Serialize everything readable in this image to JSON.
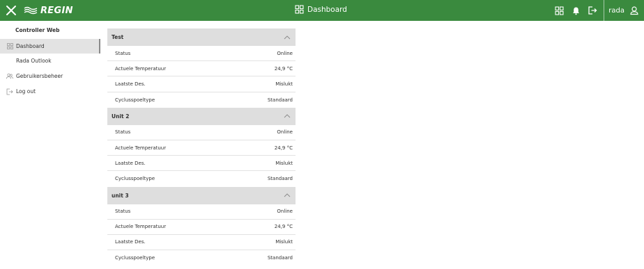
{
  "topbar": {
    "brand": "REGIN",
    "title": "Dashboard",
    "user": "rada"
  },
  "sidebar": {
    "title": "Controller Web",
    "items": [
      {
        "label": "Dashboard",
        "icon": "grid-icon",
        "active": true
      },
      {
        "label": "Rada Outlook",
        "icon": "",
        "active": false
      },
      {
        "label": "Gebruikersbeheer",
        "icon": "users-icon",
        "active": false
      },
      {
        "label": "Log out",
        "icon": "logout-icon",
        "active": false
      }
    ]
  },
  "groups": [
    {
      "title": "Test",
      "rows": [
        {
          "label": "Status",
          "value": "Online"
        },
        {
          "label": "Actuele Temperatuur",
          "value": "24,9 °C"
        },
        {
          "label": "Laatste Des.",
          "value": "Mislukt"
        },
        {
          "label": "Cyclusspoeltype",
          "value": "Standaard"
        }
      ]
    },
    {
      "title": "Unit 2",
      "rows": [
        {
          "label": "Status",
          "value": "Online"
        },
        {
          "label": "Actuele Temperatuur",
          "value": "24,9 °C"
        },
        {
          "label": "Laatste Des.",
          "value": "Mislukt"
        },
        {
          "label": "Cyclusspoeltype",
          "value": "Standaard"
        }
      ]
    },
    {
      "title": "unit 3",
      "rows": [
        {
          "label": "Status",
          "value": "Online"
        },
        {
          "label": "Actuele Temperatuur",
          "value": "24,9 °C"
        },
        {
          "label": "Laatste Des.",
          "value": "Mislukt"
        },
        {
          "label": "Cyclusspoeltype",
          "value": "Standaard"
        }
      ]
    }
  ],
  "colors": {
    "topbar": "#3a8a3e",
    "group_header": "#dedede",
    "active_item": "#e3e3e3"
  }
}
